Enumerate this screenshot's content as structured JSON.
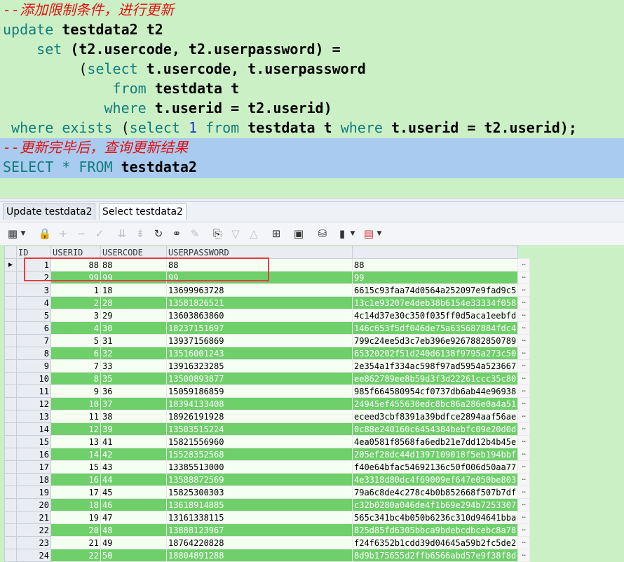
{
  "editor": {
    "comment1": "--添加限制条件，进行更新",
    "l1_kw": "update",
    "l1_rest": " testdata2 t2",
    "l2_kw": "set",
    "l2_rest": " (t2.usercode, t2.userpassword) =",
    "l3_open": "(",
    "l3_kw": "select",
    "l3_rest": " t.usercode, t.userpassword",
    "l4_kw": "from",
    "l4_rest": " testdata t",
    "l5_kw": "where",
    "l5_rest": " t.userid = t2.userid)",
    "l6_kw1": "where",
    "l6_kw2": "exists",
    "l6_open": " (",
    "l6_kw3": "select",
    "l6_num": "1",
    "l6_kw4": "from",
    "l6_mid": " testdata t ",
    "l6_kw5": "where",
    "l6_rest": " t.userid = t2.userid);",
    "comment2": "--更新完毕后，查询更新结果",
    "l8_kw1": "SELECT",
    "l8_star": " * ",
    "l8_kw2": "FROM",
    "l8_rest": " testdata2"
  },
  "tabs": [
    {
      "label": "Update testdata2"
    },
    {
      "label": "Select testdata2"
    }
  ],
  "toolbar_icons": [
    "grid-icon",
    "lock-icon",
    "plus-icon",
    "minus-icon",
    "check-icon",
    "filter-down-icon",
    "filter-icon",
    "refresh-icon",
    "binoculars-icon",
    "eraser-icon",
    "export-icon",
    "arrow-down-icon",
    "arrow-up-icon",
    "tree-icon",
    "save-icon",
    "database-icon",
    "chart-icon",
    "table-red-icon"
  ],
  "grid": {
    "headers": [
      "ID",
      "USERID",
      "USERCODE",
      "USERPASSWORD"
    ],
    "rows": [
      [
        "1",
        "88",
        "88",
        "88",
        "88"
      ],
      [
        "2",
        "99",
        "99",
        "99",
        "99"
      ],
      [
        "3",
        "1",
        "18",
        "13699963728",
        "6615c93faa74d0564a252097e9fad9c5"
      ],
      [
        "4",
        "2",
        "28",
        "13581826521",
        "13c1e93207e4deb38b6154e33334f058"
      ],
      [
        "5",
        "3",
        "29",
        "13603863860",
        "4c14d37e30c350f035ff0d5aca1eebfd"
      ],
      [
        "6",
        "4",
        "30",
        "18237151697",
        "146c653f5df046de75a635687884fdc4"
      ],
      [
        "7",
        "5",
        "31",
        "13937156869",
        "799c24ee5d3c7eb396e9267882850789"
      ],
      [
        "8",
        "6",
        "32",
        "13516001243",
        "65320202f51d240d6138f9795a273c50"
      ],
      [
        "9",
        "7",
        "33",
        "13916323285",
        "2e354a1f334ac598f97ad5954a523667"
      ],
      [
        "10",
        "8",
        "35",
        "13500893877",
        "ee862789ee8b59d3f3d22261ccc35c80"
      ],
      [
        "11",
        "9",
        "36",
        "15059186859",
        "985f664580954cf0737db6ab44e96938"
      ],
      [
        "12",
        "10",
        "37",
        "18394133408",
        "24945ef455630edc8bc86a286e0a4a51"
      ],
      [
        "13",
        "11",
        "38",
        "18926191928",
        "eceed3cbf8391a39bdfce2894aaf56ae"
      ],
      [
        "14",
        "12",
        "39",
        "13503515224",
        "0c88e240160c6454384bebfc09e20d0d"
      ],
      [
        "15",
        "13",
        "41",
        "15821556960",
        "4ea0581f8568fa6edb21e7dd12b4b45e"
      ],
      [
        "16",
        "14",
        "42",
        "15528352568",
        "205ef28dc44d1397109018f5eb194bbf"
      ],
      [
        "17",
        "15",
        "43",
        "13385513000",
        "f40e64bfac54692136c50f006d50aa77"
      ],
      [
        "18",
        "16",
        "44",
        "13588872569",
        "4e3318d80dc4f69009ef647e050be803"
      ],
      [
        "19",
        "17",
        "45",
        "15825300303",
        "79a6c8de4c278c4b0b852668f507b7df"
      ],
      [
        "20",
        "18",
        "46",
        "13618914885",
        "c32b0280a046de4f1b69e294b7253307"
      ],
      [
        "21",
        "19",
        "47",
        "13161338115",
        "565c341bc4b050b6236c310d94641bba"
      ],
      [
        "22",
        "20",
        "48",
        "13888123967",
        "825d85fd6305bbca9bdebcdbcebc8a78"
      ],
      [
        "23",
        "21",
        "49",
        "18764220828",
        "f24f6352b1cdd39d04645a59b2fc5de2"
      ],
      [
        "24",
        "22",
        "50",
        "18804891288",
        "8d9b175655d2ffb6566abd57e9f38f8d"
      ]
    ]
  }
}
